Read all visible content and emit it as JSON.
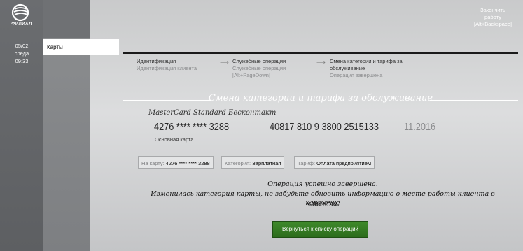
{
  "brand": {
    "name": "ФИЛИАЛ",
    "logo_icon": "sber-logo-icon"
  },
  "datetime": {
    "date": "05/02",
    "weekday": "среда",
    "time": "09:33"
  },
  "nav": {
    "active_tab": "Карты"
  },
  "header": {
    "end_work_line1": "Закончить",
    "end_work_line2": "работу",
    "end_work_shortcut": "[Alt+Backspace]"
  },
  "steps": [
    {
      "title": "Идентификация",
      "subtitle": "Идентификация клиента",
      "shortcut": ""
    },
    {
      "title": "Служебные операции",
      "subtitle": "Служебные операции",
      "shortcut": "[Alt+PageDown]"
    },
    {
      "title_line1": "Смена категории и тарифа за",
      "title_line2": "обслуживание",
      "subtitle": "Операция завершена"
    }
  ],
  "section_title": "Смена категории и тарифа за обслуживание",
  "card": {
    "type": "MasterCard Standard Бесконтакт",
    "number": "4276 **** **** 3288",
    "number_label": "Основная карта",
    "account": "40817 810 9 3800 2515133",
    "expiry": "11.2016"
  },
  "info": {
    "card_key": "На карту:",
    "card_val": "4276 **** **** 3288",
    "category_key": "Категория:",
    "category_val": "Зарплатная",
    "tariff_key": "Тариф:",
    "tariff_val": "Оплата предприятием"
  },
  "messages": {
    "line1": "Операция успешно завершена.",
    "line2": "Изменилась категория карты, не забудьте обновить информацию о месте работы клиента в карточке",
    "line3": "клиента."
  },
  "buttons": {
    "back": "Вернуться к списку операций"
  },
  "colors": {
    "accent_green": "#2e6e1e",
    "sidebar_dark": "#5d5f62"
  }
}
